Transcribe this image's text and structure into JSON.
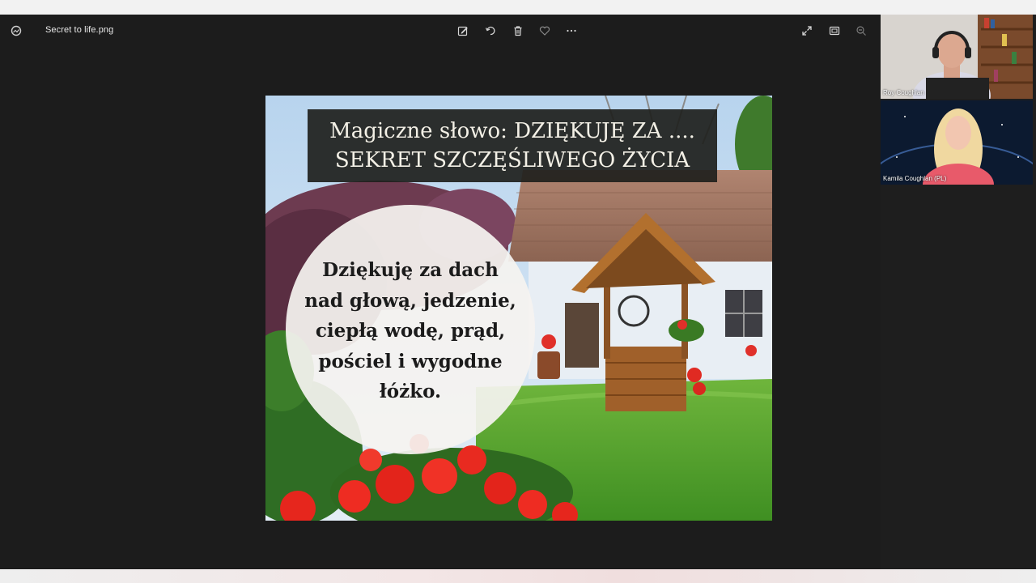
{
  "viewer": {
    "file_name": "Secret to life.png",
    "toolbar": {
      "icons": [
        "edit-image-icon",
        "rotate-icon",
        "delete-icon",
        "favorite-icon",
        "more-icon"
      ],
      "right_icons": [
        "fullscreen-icon",
        "fit-window-icon",
        "zoom-out-icon"
      ]
    }
  },
  "slide": {
    "title_line1": "Magiczne słowo:  DZIĘKUJĘ ZA ....",
    "title_line2": "SEKRET SZCZĘŚLIWEGO ŻYCIA",
    "circle_lines": [
      "Dziękuję za dach",
      "nad głową, jedzenie,",
      "ciepłą wodę, prąd,",
      "pościel i wygodne",
      "łóżko."
    ]
  },
  "participants": [
    {
      "name": "Roy Coughlan"
    },
    {
      "name": "Kamila Coughlan (PL)"
    }
  ],
  "colors": {
    "viewer_bg": "#1c1c1c",
    "title_box_bg": "#1e201c",
    "circle_bg": "#f5f3f0"
  }
}
